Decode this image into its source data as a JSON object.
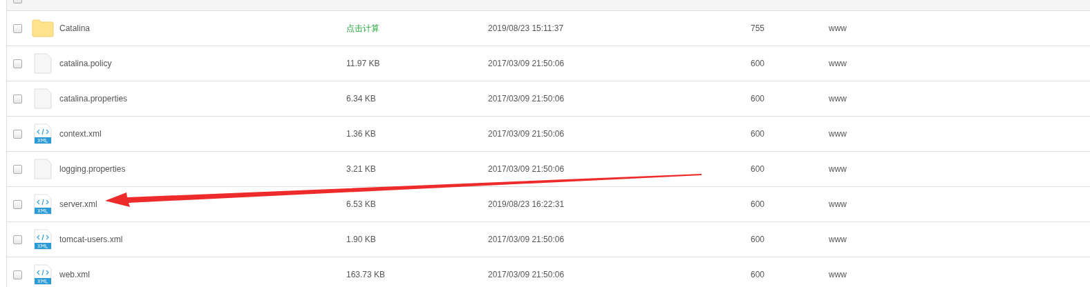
{
  "table": {
    "header_checkbox": {
      "checked": false
    },
    "rows": [
      {
        "kind": "folder",
        "name": "Catalina",
        "size": "点击计算",
        "size_is_link": true,
        "modified": "2019/08/23 15:11:37",
        "permission": "755",
        "owner": "www",
        "checked": false
      },
      {
        "kind": "file",
        "name": "catalina.policy",
        "size": "11.97 KB",
        "size_is_link": false,
        "modified": "2017/03/09 21:50:06",
        "permission": "600",
        "owner": "www",
        "checked": false
      },
      {
        "kind": "file",
        "name": "catalina.properties",
        "size": "6.34 KB",
        "size_is_link": false,
        "modified": "2017/03/09 21:50:06",
        "permission": "600",
        "owner": "www",
        "checked": false
      },
      {
        "kind": "xml",
        "name": "context.xml",
        "size": "1.36 KB",
        "size_is_link": false,
        "modified": "2017/03/09 21:50:06",
        "permission": "600",
        "owner": "www",
        "checked": false
      },
      {
        "kind": "file",
        "name": "logging.properties",
        "size": "3.21 KB",
        "size_is_link": false,
        "modified": "2017/03/09 21:50:06",
        "permission": "600",
        "owner": "www",
        "checked": false
      },
      {
        "kind": "xml",
        "name": "server.xml",
        "size": "6.53 KB",
        "size_is_link": false,
        "modified": "2019/08/23 16:22:31",
        "permission": "600",
        "owner": "www",
        "checked": false
      },
      {
        "kind": "xml",
        "name": "tomcat-users.xml",
        "size": "1.90 KB",
        "size_is_link": false,
        "modified": "2017/03/09 21:50:06",
        "permission": "600",
        "owner": "www",
        "checked": false
      },
      {
        "kind": "xml",
        "name": "web.xml",
        "size": "163.73 KB",
        "size_is_link": false,
        "modified": "2017/03/09 21:50:06",
        "permission": "600",
        "owner": "www",
        "checked": false
      }
    ]
  }
}
